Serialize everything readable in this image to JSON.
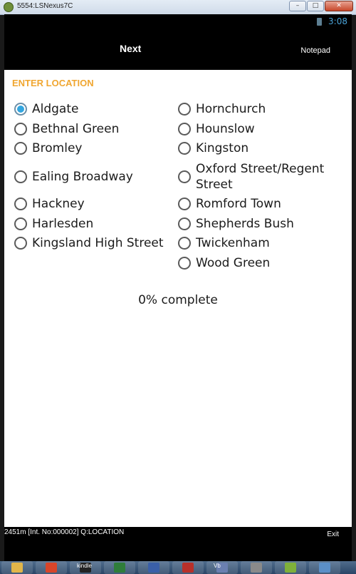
{
  "window": {
    "title": "5554:LSNexus7C",
    "buttons": {
      "minimize": "–",
      "maximize": "□",
      "close": "✕"
    }
  },
  "status_bar": {
    "time": "3:08"
  },
  "action_bar": {
    "next_label": "Next",
    "notepad_label": "Notepad"
  },
  "question": {
    "title": "ENTER LOCATION",
    "selected": "Aldgate",
    "left_options": [
      {
        "label": "Aldgate",
        "checked": true
      },
      {
        "label": "Bethnal Green",
        "checked": false
      },
      {
        "label": "Bromley",
        "checked": false
      },
      {
        "label": "Ealing Broadway",
        "checked": false
      },
      {
        "label": "Hackney",
        "checked": false
      },
      {
        "label": "Harlesden",
        "checked": false
      },
      {
        "label": "Kingsland High Street",
        "checked": false
      }
    ],
    "right_options": [
      {
        "label": "Hornchurch",
        "checked": false
      },
      {
        "label": "Hounslow",
        "checked": false
      },
      {
        "label": "Kingston",
        "checked": false
      },
      {
        "label": "Oxford Street/Regent Street",
        "checked": false
      },
      {
        "label": "Romford Town",
        "checked": false
      },
      {
        "label": "Shepherds Bush",
        "checked": false
      },
      {
        "label": "Twickenham",
        "checked": false
      },
      {
        "label": "Wood Green",
        "checked": false
      }
    ],
    "progress_text": "0% complete",
    "progress_percent": 0
  },
  "info_bar": {
    "text": "2451m  [Int. No:000002]  Q:LOCATION",
    "exit_label": "Exit"
  },
  "taskbar": {
    "items": [
      {
        "icon": "folder-icon",
        "color": "#e2b64a"
      },
      {
        "icon": "html5-icon",
        "color": "#d8452a"
      },
      {
        "icon": "kindle-icon",
        "color": "#222222",
        "text": "kindle"
      },
      {
        "icon": "excel-icon",
        "color": "#2f7d3a"
      },
      {
        "icon": "app-icon",
        "color": "#3a5fa8"
      },
      {
        "icon": "app-red-icon",
        "color": "#b8302a"
      },
      {
        "icon": "vb-icon",
        "color": "#6a7fb0",
        "text": "Vb"
      },
      {
        "icon": "disc-icon",
        "color": "#8a8a8a"
      },
      {
        "icon": "android-icon",
        "color": "#7fb03a"
      },
      {
        "icon": "app-blue-icon",
        "color": "#5b8fc7"
      }
    ]
  }
}
